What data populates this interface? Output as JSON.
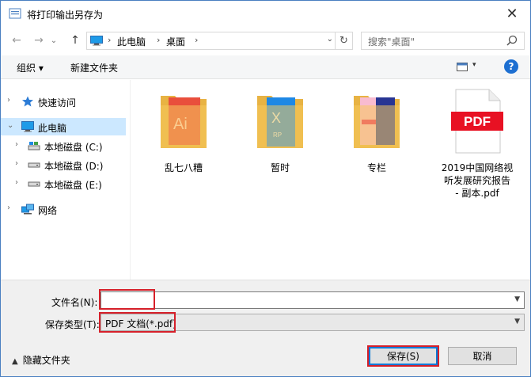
{
  "window": {
    "title": "将打印输出另存为",
    "close_glyph": "✕"
  },
  "nav": {
    "back_glyph": "←",
    "forward_glyph": "→",
    "recent_glyph": "⌄",
    "up_glyph": "↑",
    "breadcrumb": [
      "此电脑",
      "桌面"
    ],
    "crumb_sep": "›",
    "dropdown_glyph": "⌄",
    "refresh_glyph": "↻",
    "search_placeholder": "搜索\"桌面\""
  },
  "toolbar": {
    "organize": "组织 ▾",
    "new_folder": "新建文件夹",
    "view_dropdown_glyph": "▾",
    "help_glyph": "?"
  },
  "tree": [
    {
      "label": "快速访问",
      "icon": "star-icon",
      "level": 0,
      "expanded": false,
      "selected": false
    },
    {
      "label": "此电脑",
      "icon": "computer-icon",
      "level": 0,
      "expanded": true,
      "selected": true
    },
    {
      "label": "本地磁盘 (C:)",
      "icon": "drive-icon",
      "level": 1,
      "expanded": false,
      "selected": false
    },
    {
      "label": "本地磁盘 (D:)",
      "icon": "drive-icon",
      "level": 1,
      "expanded": false,
      "selected": false
    },
    {
      "label": "本地磁盘 (E:)",
      "icon": "drive-icon",
      "level": 1,
      "expanded": false,
      "selected": false
    },
    {
      "label": "网络",
      "icon": "network-icon",
      "level": 0,
      "expanded": false,
      "selected": false
    }
  ],
  "files": [
    {
      "name": "乱七八糟",
      "type": "folder",
      "accent": "#e94e3c"
    },
    {
      "name": "暂时",
      "type": "folder",
      "accent": "#1e88e5"
    },
    {
      "name": "专栏",
      "type": "folder",
      "accent": "#283593"
    },
    {
      "name": "2019中国网络视听发展研究报告 - 副本.pdf",
      "name_lines": [
        "2019中国网络视",
        "听发展研究报告",
        "- 副本.pdf"
      ],
      "type": "pdf",
      "accent": "#e81123",
      "badge": "PDF"
    }
  ],
  "thumb_text": {
    "ai_logo": "Ai",
    "x_logo": "X",
    "rp": "RP"
  },
  "form": {
    "filename_label": "文件名(N):",
    "filename_value": "",
    "filetype_label": "保存类型(T):",
    "filetype_value": "PDF 文档(*.pdf)"
  },
  "footer": {
    "hide_folders": "隐藏文件夹",
    "hide_caret": "▲",
    "save": "保存(S)",
    "cancel": "取消"
  },
  "colors": {
    "selection": "#cce8ff",
    "highlight_box": "#d6202a",
    "folder": "#f5c95c",
    "primary_border": "#0078d7",
    "help": "#1d6fd1"
  }
}
